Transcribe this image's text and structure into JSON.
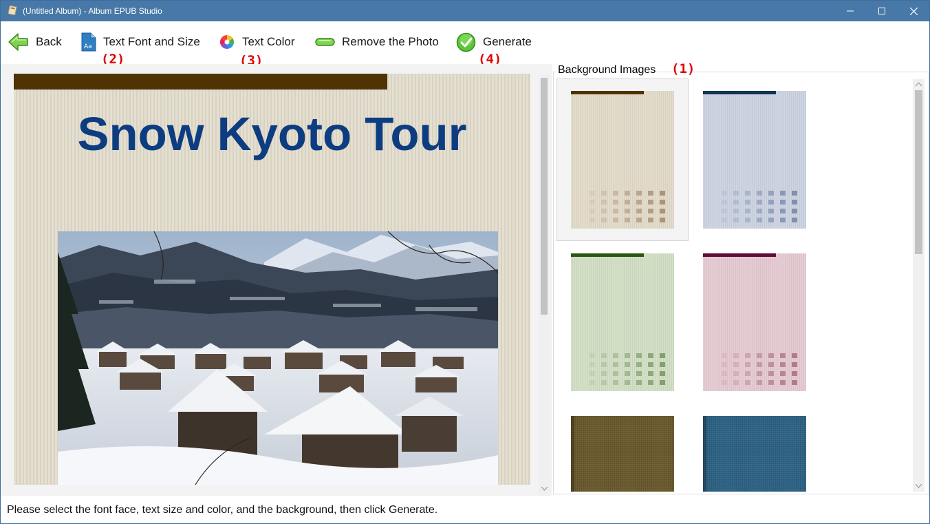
{
  "window": {
    "title": "(Untitled Album) - Album EPUB Studio",
    "controls": [
      "minimize-icon",
      "maximize-icon",
      "close-icon"
    ]
  },
  "toolbar": {
    "back_label": "Back",
    "font_label": "Text Font and Size",
    "color_label": "Text Color",
    "remove_label": "Remove the Photo",
    "generate_label": "Generate"
  },
  "markers": {
    "m1": "(1)",
    "m2": "(2)",
    "m3": "(3)",
    "m4": "(4)"
  },
  "preview": {
    "title": "Snow Kyoto Tour",
    "title_color": "#0d3d80",
    "top_bar_color": "#4f3304"
  },
  "backgrounds": {
    "label": "Background Images",
    "selected_index": 0,
    "items": [
      {
        "name": "beige",
        "bar": "#4f3304",
        "base": "#e3dccb",
        "square": "#a88e72"
      },
      {
        "name": "blue-gray",
        "bar": "#0e3556",
        "base": "#cdd4e2",
        "square": "#7b8aac"
      },
      {
        "name": "green",
        "bar": "#2e5510",
        "base": "#d3e0c6",
        "square": "#7f9a68"
      },
      {
        "name": "pink",
        "bar": "#5e0d38",
        "base": "#e6cbd3",
        "square": "#ab7585"
      },
      {
        "name": "olive-linen",
        "base": "#6b5a2e"
      },
      {
        "name": "blue-linen",
        "base": "#2e6385"
      }
    ]
  },
  "status": {
    "message": "Please select the font face, text size and color, and the background, then click Generate."
  }
}
